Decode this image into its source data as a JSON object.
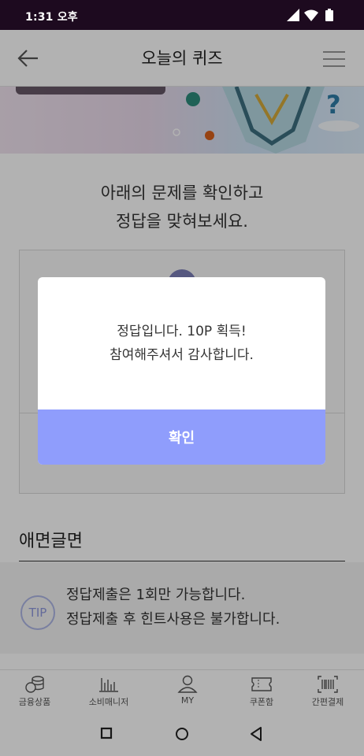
{
  "status_bar": {
    "time": "1:31 오후"
  },
  "app_bar": {
    "title": "오늘의 퀴즈"
  },
  "question": {
    "line1": "아래의 문제를 확인하고",
    "line2": "정답을 맞혀보세요."
  },
  "section": {
    "title": "애면글면"
  },
  "tip": {
    "badge": "TIP",
    "line1": "정답제출은 1회만 가능합니다.",
    "line2": "정답제출 후 힌트사용은 불가합니다."
  },
  "bottom_nav": {
    "items": [
      {
        "label": "금융상품",
        "icon": "coins-icon"
      },
      {
        "label": "소비매니저",
        "icon": "bar-chart-icon"
      },
      {
        "label": "MY",
        "icon": "person-icon"
      },
      {
        "label": "쿠폰함",
        "icon": "ticket-icon"
      },
      {
        "label": "간편결제",
        "icon": "barcode-icon"
      }
    ]
  },
  "dialog": {
    "line1": "정답입니다. 10P 획득!",
    "line2": "참여해주셔서 감사합니다.",
    "confirm_label": "확인"
  },
  "colors": {
    "accent": "#8f9dfc",
    "status_bar": "#1d0a1f",
    "tip": "#8f99dd"
  }
}
